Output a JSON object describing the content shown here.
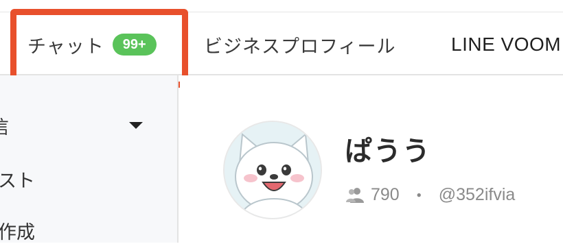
{
  "tabs": {
    "chat": {
      "label": "チャット",
      "badge": "99+"
    },
    "business_profile": {
      "label": "ビジネスプロフィール"
    },
    "line_voom": {
      "label": "LINE VOOM"
    }
  },
  "sidebar": {
    "items": [
      {
        "label": "信"
      },
      {
        "label": "スト"
      },
      {
        "label": "作成"
      }
    ]
  },
  "profile": {
    "name": "ぱうう",
    "followers": "790",
    "separator": "・",
    "line_id": "@352ifvia"
  },
  "colors": {
    "badge": "#5ac35a",
    "highlight": "#e8502c"
  }
}
